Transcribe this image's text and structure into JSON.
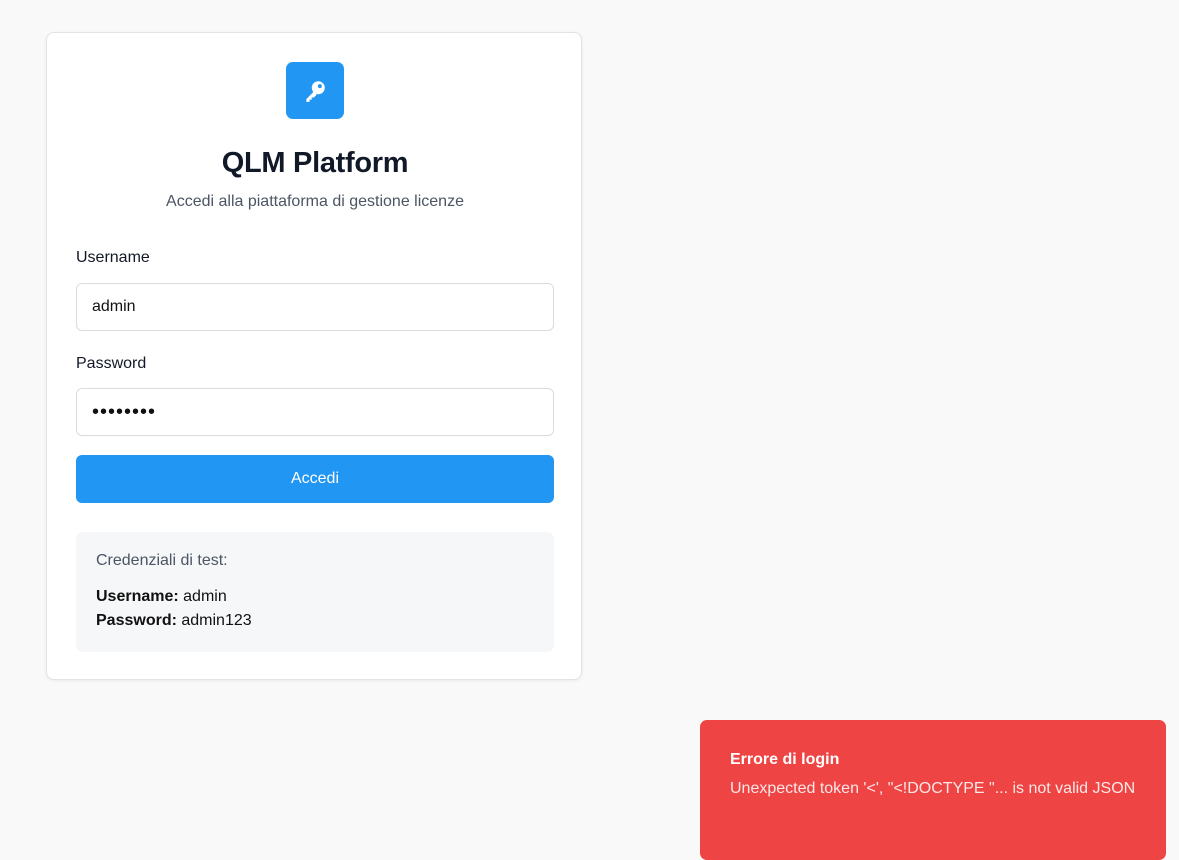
{
  "app": {
    "title": "QLM Platform",
    "subtitle": "Accedi alla piattaforma di gestione licenze",
    "logo_icon": "key-icon",
    "accent_color": "#2196f3"
  },
  "form": {
    "username_label": "Username",
    "username_value": "admin",
    "password_label": "Password",
    "password_value": "admin123",
    "submit_label": "Accedi"
  },
  "test_credentials": {
    "heading": "Credenziali di test:",
    "username_label": "Username:",
    "username_value": "admin",
    "password_label": "Password:",
    "password_value": "admin123"
  },
  "toast": {
    "title": "Errore di login",
    "message": "Unexpected token '<', \"<!DOCTYPE \"... is not valid JSON",
    "color": "#ef4444"
  }
}
